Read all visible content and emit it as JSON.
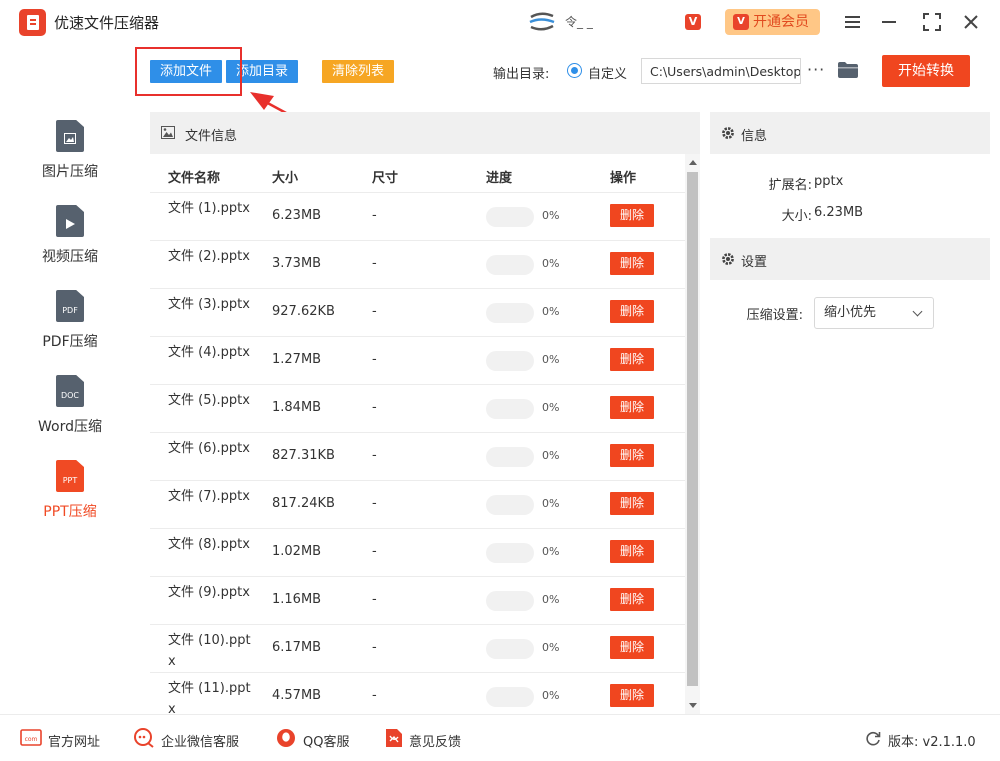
{
  "app": {
    "title": "优速文件压缩器",
    "user_name": "令_ _"
  },
  "titlebar": {
    "vip_label": "开通会员"
  },
  "sidebar": {
    "items": [
      {
        "label": "图片压缩",
        "icon": "image-file-icon",
        "tag": ""
      },
      {
        "label": "视频压缩",
        "icon": "video-file-icon",
        "tag": ""
      },
      {
        "label": "PDF压缩",
        "icon": "pdf-file-icon",
        "tag": "PDF"
      },
      {
        "label": "Word压缩",
        "icon": "doc-file-icon",
        "tag": "DOC"
      },
      {
        "label": "PPT压缩",
        "icon": "ppt-file-icon",
        "tag": "PPT",
        "active": true
      }
    ]
  },
  "toolbar": {
    "add_file": "添加文件",
    "add_dir": "添加目录",
    "clear_list": "清除列表",
    "output_label": "输出目录:",
    "output_option": "自定义",
    "output_path": "C:\\Users\\admin\\Desktop",
    "more": "···",
    "start": "开始转换"
  },
  "file_panel": {
    "title": "文件信息",
    "columns": {
      "name": "文件名称",
      "size": "大小",
      "dim": "尺寸",
      "progress": "进度",
      "action": "操作"
    },
    "rows": [
      {
        "name": "文件 (1).pptx",
        "size": "6.23MB",
        "dim": "-",
        "progress": 0,
        "pct": "0%",
        "action": "删除"
      },
      {
        "name": "文件 (2).pptx",
        "size": "3.73MB",
        "dim": "-",
        "progress": 0,
        "pct": "0%",
        "action": "删除"
      },
      {
        "name": "文件 (3).pptx",
        "size": "927.62KB",
        "dim": "-",
        "progress": 0,
        "pct": "0%",
        "action": "删除"
      },
      {
        "name": "文件 (4).pptx",
        "size": "1.27MB",
        "dim": "-",
        "progress": 0,
        "pct": "0%",
        "action": "删除"
      },
      {
        "name": "文件 (5).pptx",
        "size": "1.84MB",
        "dim": "-",
        "progress": 0,
        "pct": "0%",
        "action": "删除"
      },
      {
        "name": "文件 (6).pptx",
        "size": "827.31KB",
        "dim": "-",
        "progress": 0,
        "pct": "0%",
        "action": "删除"
      },
      {
        "name": "文件 (7).pptx",
        "size": "817.24KB",
        "dim": "-",
        "progress": 0,
        "pct": "0%",
        "action": "删除"
      },
      {
        "name": "文件 (8).pptx",
        "size": "1.02MB",
        "dim": "-",
        "progress": 0,
        "pct": "0%",
        "action": "删除"
      },
      {
        "name": "文件 (9).pptx",
        "size": "1.16MB",
        "dim": "-",
        "progress": 0,
        "pct": "0%",
        "action": "删除"
      },
      {
        "name": "文件 (10).pptx",
        "size": "6.17MB",
        "dim": "-",
        "progress": 0,
        "pct": "0%",
        "action": "删除"
      },
      {
        "name": "文件 (11).pptx",
        "size": "4.57MB",
        "dim": "-",
        "progress": 0,
        "pct": "0%",
        "action": "删除"
      }
    ]
  },
  "info_panel": {
    "title": "信息",
    "ext_label": "扩展名:",
    "ext_value": "pptx",
    "size_label": "大小:",
    "size_value": "6.23MB"
  },
  "settings_panel": {
    "title": "设置",
    "compress_label": "压缩设置:",
    "compress_value": "缩小优先"
  },
  "footer": {
    "website": "官方网址",
    "wechat": "企业微信客服",
    "qq": "QQ客服",
    "feedback": "意见反馈",
    "version": "版本: v2.1.1.0"
  },
  "colors": {
    "accent_red": "#f0461f",
    "accent_blue": "#2f8fe8",
    "accent_orange": "#f6a623",
    "vip_bg": "#ffc786"
  }
}
